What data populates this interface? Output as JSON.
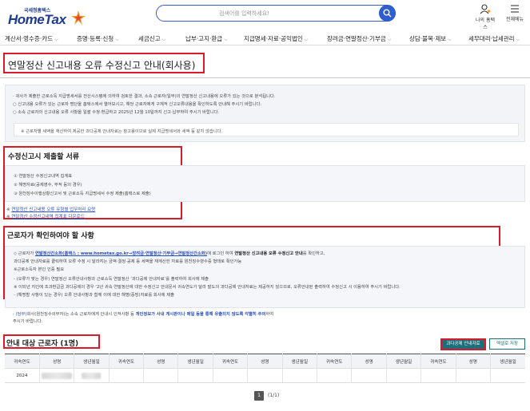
{
  "header": {
    "logo_small": "국세청홈택스",
    "logo_big": "HomeTax",
    "search_placeholder": "검색어를 입력하세요!",
    "my_hometax": "나의 홈택스",
    "all_menu": "전체메뉴"
  },
  "gnb": [
    "계산서·영수증·카드",
    "증명·등록·신청",
    "세금신고",
    "납부·고지·환급",
    "지급명세·자료·공익법인",
    "장려금·연말정산·기부금",
    "상담·불복·제보",
    "세무대리·납세관리"
  ],
  "page_title": "연말정산 신고내용 오류 수정신고 안내(회사용)",
  "notice": {
    "lines": [
      "· 귀사가 제출한 근로소득 지급명세서를 전산시스템에 의하여 검토한 결과, 소속 근로자(일부)의 연말정산 신고내용에 오류가 있는 것으로 분석됩니다.",
      "  ○ 신고내용 오류가 있는 근로자 명단을 홈택스에서 열어보시고, 해당 근로자에게 구체적 신고오류내용을 확인하도록 안내해 주시기 바랍니다.",
      "  ○ 소속 근로자의 신고내용 오류 사항을 일괄 수정·환급하고 2025년 12월 10일까지 신고·납부하여 주시기 바랍니다."
    ],
    "inner": "※ 근로자별 세액을 재산하여 제공한 과다공제 안내자료는 참고용이므로 실제 지급명세서와 세액 등 같지 않습니다."
  },
  "docs": {
    "title": "수정신고시 제출할 서류",
    "items": [
      "① 연말정산 수정신고내역 집계표",
      "② 해명자료(공제영수, 부적 등의 경우)",
      "③ 원천징수이행상황신고서 및 근로소득 지급명세서 수정 제출(홈택스로 제출)"
    ],
    "link1_prefix": "※ ",
    "link1": "연말정산 신고내용 오류 유형별 업무처리 요령",
    "link2_prefix": "※ ",
    "link2": "연말정산 수정신고내역 집계표 다운로드"
  },
  "check": {
    "title": "근로자가 확인하여야 할 사항",
    "line1_a": "◇ 근로자가 ",
    "line1_b": "연말정산간소화(홈택스 : www.hometax.go.kr→장려금·연말정산·기부금→연말정산간소화)",
    "line1_c": "에 로그인 하여 ",
    "line1_d": "연말정산 신고내용 오류 수정신고 안내",
    "line1_e": "를 확인하고,",
    "line2": "  과다공제 안내자료를 클릭하여 오류 수정 시 달라지는 금액·결정·공제 등 세액을 재계산한 자료를 원천징수영수증 형태로 확인가능",
    "line3": "  ※근로소득자 본인 인증 필요",
    "line4": "- (오류가 맞는 경우) 연말정산 오류안내사항과 근로소득 연말정산 ‘과다공제 안내자료’를 출력하여 회사에 제출",
    "line5": "  ※ 이되년 지인에 조과환급금 과다공제의 경우 ‘2년 귀속 연말정산에 대한 수정신고 안내문서 귀속연도가 달라 발도의 과다공제 안내자료는 제공하지 않으므로, 오류안내된 출력하여 수정신고 시 이용하여 주시기 바랍니다.",
    "line6": "- (해명할 사항이 있는 경우) 오류 안내사항과 함께 이에 대한 해명(증빙)자료를 회사에 제출"
  },
  "warn": {
    "line1_a": "- ",
    "line1_b": "(당부)",
    "line1_c": "회사(원천징수의무자)는 소속 근로자에게 안내시 인적사항 등 ",
    "line1_d": "개인정보가 사내 게시판이나 메일 등을 통해 유출되지 않도록 각별히 주의",
    "line1_e": "하여",
    "line2": "  주시기 바랍니다."
  },
  "workers": {
    "title": "안내 대상 근로자 (1명)",
    "btn_guide": "과다공제 안내자료",
    "btn_excel": "엑셀로 저장",
    "columns": [
      "귀속연도",
      "성명",
      "생년월일",
      "귀속연도",
      "성명",
      "생년월일",
      "귀속연도",
      "성명",
      "생년월일",
      "귀속연도",
      "성명",
      "생년월일",
      "귀속연도",
      "성명",
      "생년월일"
    ],
    "rows": [
      [
        "2024",
        "",
        "",
        "",
        "",
        "",
        "",
        "",
        "",
        "",
        "",
        "",
        "",
        "",
        ""
      ]
    ]
  },
  "pager": {
    "current": "1",
    "total": "(1/1)"
  },
  "colors": {
    "brand_blue": "#1f3b8f",
    "highlight_red": "#d81b2c",
    "teal_button": "#1a6f7a",
    "link_blue": "#2a4fbf"
  }
}
